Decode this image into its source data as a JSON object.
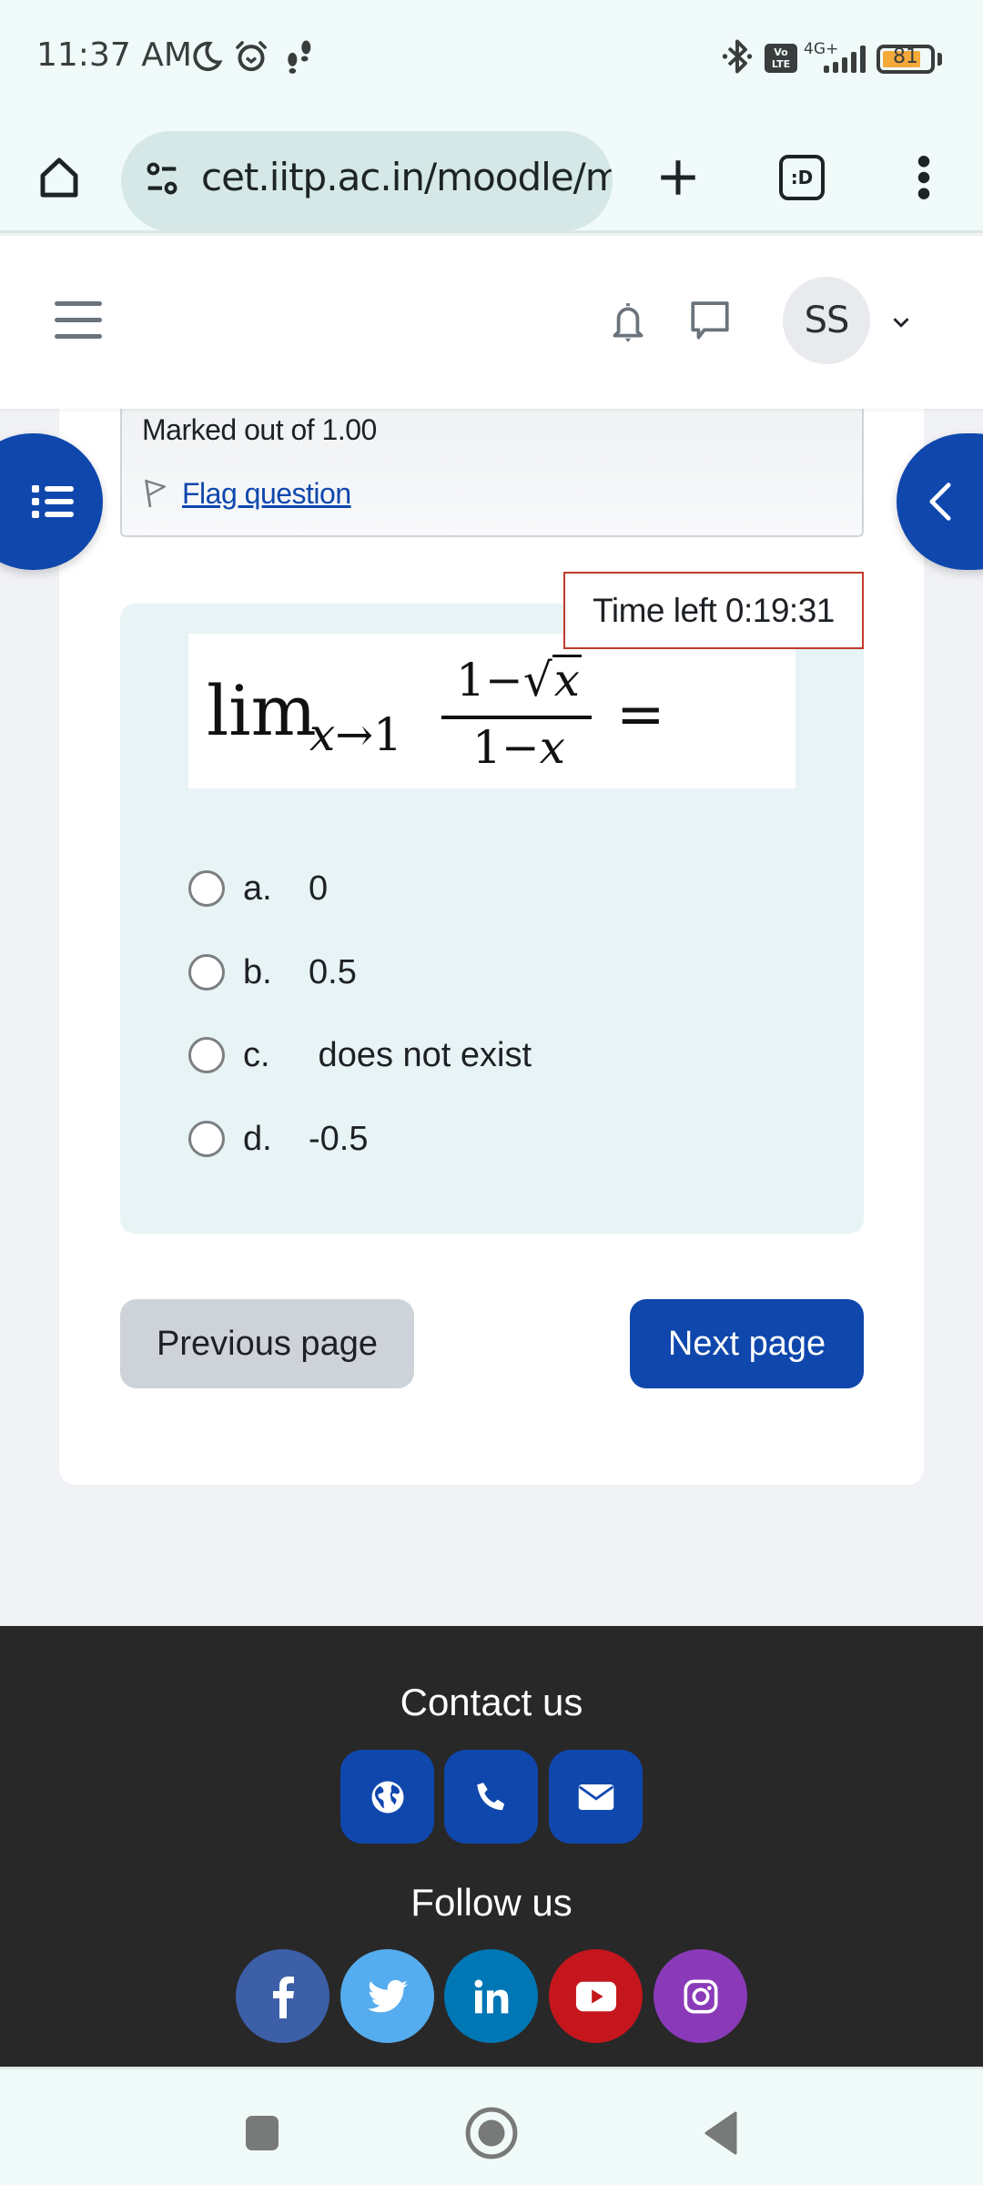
{
  "status_bar": {
    "time": "11:37 AM",
    "icons": [
      "moon-icon",
      "alarm-icon",
      "footsteps-icon",
      "bluetooth-icon",
      "volte-icon",
      "signal-icon",
      "battery-icon"
    ],
    "volte_label_top": "Vo",
    "volte_label_bottom": "LTE",
    "network_type": "4G+",
    "battery_percent": 81,
    "battery_label": "81"
  },
  "browser": {
    "url": "cet.iitp.ac.in/moodle/mod/quiz/attempt.php",
    "tab_count_label": ":D",
    "buttons": [
      "home",
      "site-settings",
      "new-tab",
      "tab-switcher",
      "menu"
    ]
  },
  "header": {
    "user_initials": "SS"
  },
  "question_info": {
    "marked_out_of": "Marked out of 1.00",
    "flag_label": "Flag question"
  },
  "timer": {
    "label": "Time left 0:19:31"
  },
  "question": {
    "formula": {
      "lim": "lim",
      "subscript_var": "x",
      "subscript_arrow": "→",
      "subscript_target": "1",
      "numerator_prefix": "1−",
      "numerator_sqrt": "x",
      "denominator_prefix": "1−",
      "denominator_var": "x",
      "equals": "="
    },
    "options": [
      {
        "letter": "a.",
        "text": "0",
        "selected": false
      },
      {
        "letter": "b.",
        "text": "0.5",
        "selected": false
      },
      {
        "letter": "c.",
        "text": " does not exist",
        "selected": false
      },
      {
        "letter": "d.",
        "text": "-0.5",
        "selected": false
      }
    ]
  },
  "navigation": {
    "previous_label": "Previous page",
    "next_label": "Next page"
  },
  "footer": {
    "contact_title": "Contact us",
    "contact_links": [
      "website",
      "phone",
      "email"
    ],
    "follow_title": "Follow us",
    "social_links": [
      {
        "name": "facebook",
        "color": "#3d5fa8"
      },
      {
        "name": "twitter",
        "color": "#55acee"
      },
      {
        "name": "linkedin",
        "color": "#0077b5"
      },
      {
        "name": "youtube",
        "color": "#c4161c"
      },
      {
        "name": "instagram",
        "color": "#8a3ab9"
      }
    ]
  },
  "colors": {
    "brand_primary": "#0f47ad",
    "timer_border": "#c0392b",
    "question_bg": "#e7f3f5",
    "footer_bg": "#282828"
  }
}
